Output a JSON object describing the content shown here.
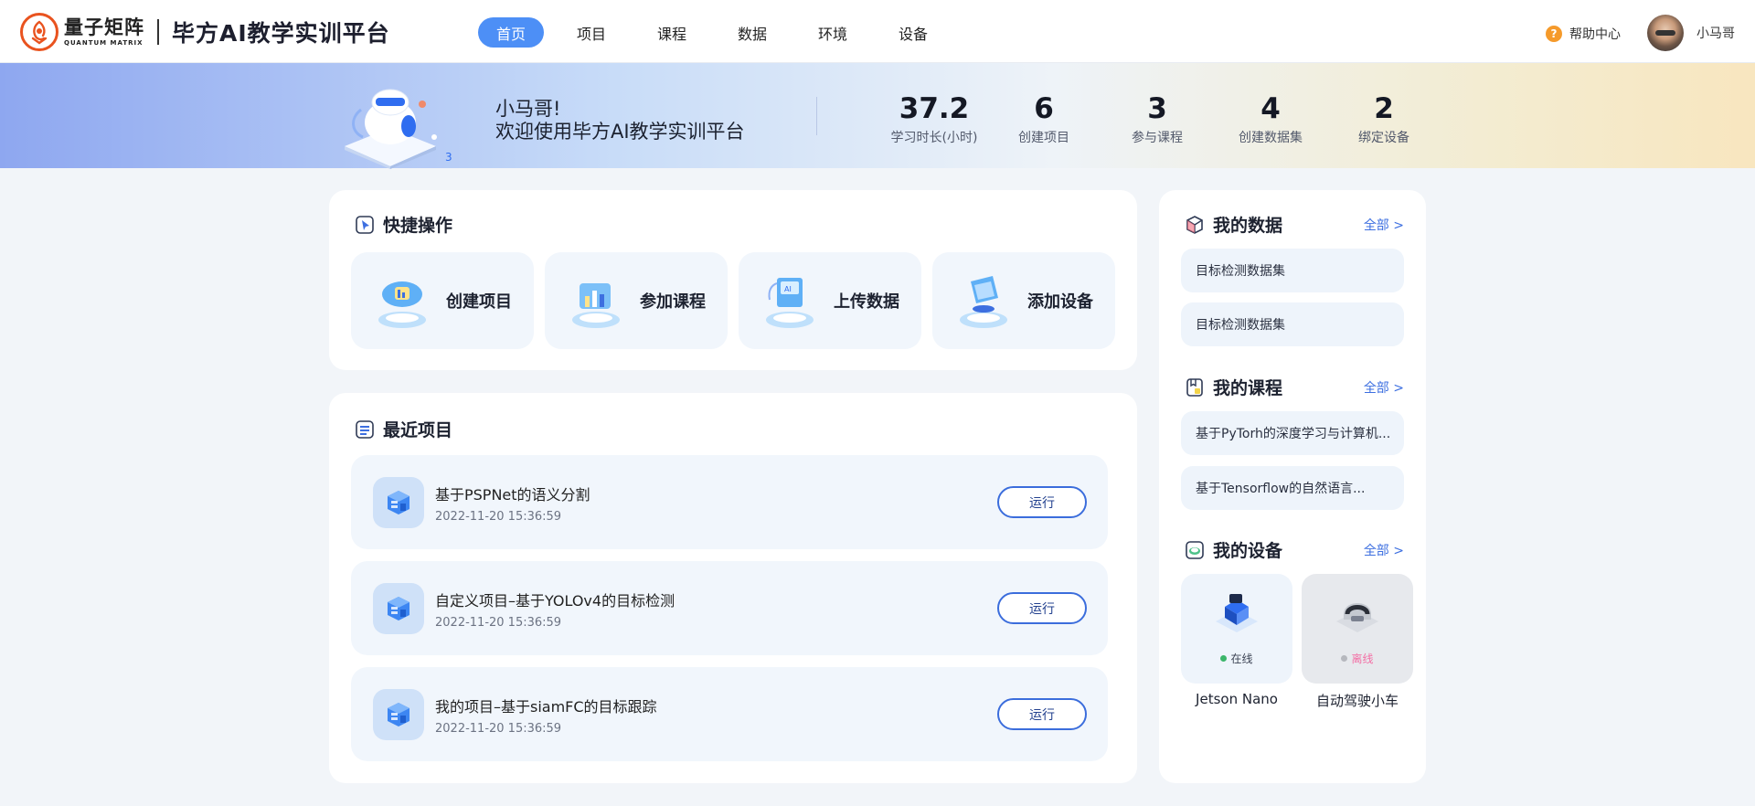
{
  "brand": {
    "company_cn": "量子矩阵",
    "company_en": "QUANTUM MATRIX",
    "platform": "毕方AI教学实训平台",
    "accent": "#4d8ff6"
  },
  "nav": {
    "items": [
      {
        "label": "首页",
        "active": true
      },
      {
        "label": "项目"
      },
      {
        "label": "课程"
      },
      {
        "label": "数据"
      },
      {
        "label": "环境"
      },
      {
        "label": "设备"
      }
    ]
  },
  "header": {
    "help": "帮助中心",
    "username": "小马哥"
  },
  "banner": {
    "greeting": "小马哥!",
    "welcome": "欢迎使用毕方AI教学实训平台",
    "stats": [
      {
        "value": "37.2",
        "label": "学习时长(小时)"
      },
      {
        "value": "6",
        "label": "创建项目"
      },
      {
        "value": "3",
        "label": "参与课程"
      },
      {
        "value": "4",
        "label": "创建数据集"
      },
      {
        "value": "2",
        "label": "绑定设备"
      }
    ]
  },
  "quick": {
    "title": "快捷操作",
    "items": [
      {
        "label": "创建项目",
        "icon": "create-project-icon"
      },
      {
        "label": "参加课程",
        "icon": "join-course-icon"
      },
      {
        "label": "上传数据",
        "icon": "upload-data-icon"
      },
      {
        "label": "添加设备",
        "icon": "add-device-icon"
      }
    ]
  },
  "recent": {
    "title": "最近项目",
    "run_label": "运行",
    "projects": [
      {
        "name": "基于PSPNet的语义分割",
        "time": "2022-11-20  15:36:59"
      },
      {
        "name": "自定义项目–基于YOLOv4的目标检测",
        "time": "2022-11-20  15:36:59"
      },
      {
        "name": "我的项目–基于siamFC的目标跟踪",
        "time": "2022-11-20  15:36:59"
      }
    ]
  },
  "my_data": {
    "title": "我的数据",
    "more": "全部 >",
    "items": [
      "目标检测数据集",
      "目标检测数据集"
    ]
  },
  "my_courses": {
    "title": "我的课程",
    "more": "全部 >",
    "items": [
      "基于PyTorh的深度学习与计算机...",
      "基于Tensorflow的自然语言..."
    ]
  },
  "my_devices": {
    "title": "我的设备",
    "more": "全部 >",
    "items": [
      {
        "name": "Jetson Nano",
        "status": "在线",
        "status_color": "#3bb56a"
      },
      {
        "name": "自动驾驶小车",
        "status": "离线",
        "status_color": "#f36fa5"
      }
    ]
  }
}
